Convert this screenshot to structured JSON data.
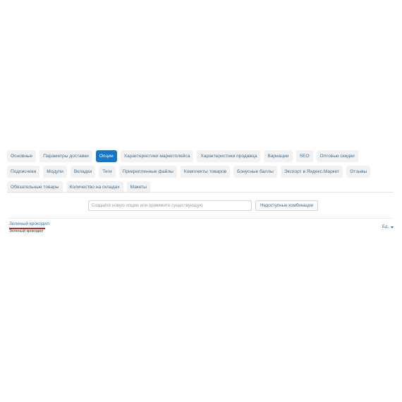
{
  "tabs": [
    {
      "label": "Основные",
      "active": false
    },
    {
      "label": "Параметры доставки",
      "active": false
    },
    {
      "label": "Опции",
      "active": true
    },
    {
      "label": "Характеристики маркетплейса",
      "active": false
    },
    {
      "label": "Характеристики продавца",
      "active": false
    },
    {
      "label": "Вариации",
      "active": false
    },
    {
      "label": "SEO",
      "active": false
    },
    {
      "label": "Оптовые скидки",
      "active": false
    },
    {
      "label": "Подписчики",
      "active": false
    },
    {
      "label": "Модули",
      "active": false
    },
    {
      "label": "Вкладки",
      "active": false
    },
    {
      "label": "Теги",
      "active": false
    },
    {
      "label": "Прикрепленные файлы",
      "active": false
    },
    {
      "label": "Комплекты товаров",
      "active": false
    },
    {
      "label": "Бонусные баллы",
      "active": false
    },
    {
      "label": "Экспорт в Яндекс.Маркет",
      "active": false
    },
    {
      "label": "Отзывы",
      "active": false
    },
    {
      "label": "Обязательные товары",
      "active": false
    },
    {
      "label": "Количество на складах",
      "active": false
    },
    {
      "label": "Макеты",
      "active": false
    }
  ],
  "options_toolbar": {
    "search_placeholder": "Создайте новую опцию или привяжите существующую",
    "unavailable_label": "Недоступные комбинации"
  },
  "option": {
    "name": "Зеленый крокодил",
    "subtitle": "Зеленый крокодил"
  },
  "currency": {
    "label": "Бд."
  },
  "colors": {
    "active_tab": "#1577c6",
    "link": "#2b73b8",
    "underline": "#d42020"
  }
}
